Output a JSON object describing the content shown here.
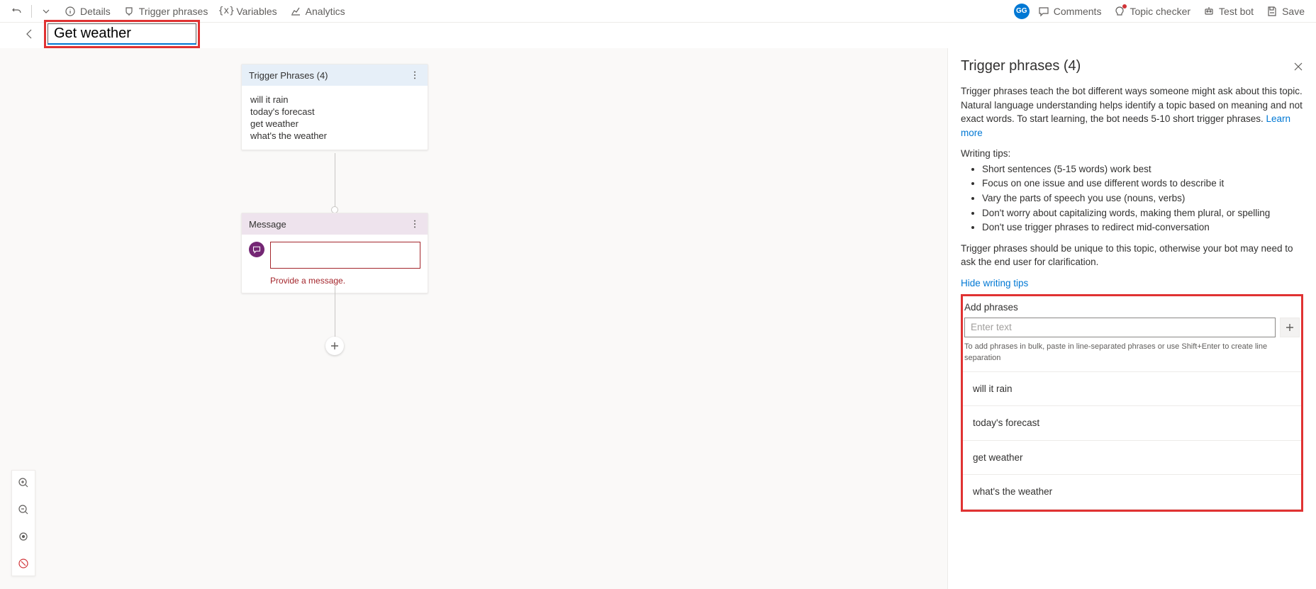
{
  "toolbar": {
    "undo_title": "Undo",
    "details": "Details",
    "trigger_phrases": "Trigger phrases",
    "variables": "Variables",
    "analytics": "Analytics",
    "avatar_initials": "GG",
    "comments": "Comments",
    "topic_checker": "Topic checker",
    "test_bot": "Test bot",
    "save": "Save"
  },
  "topic": {
    "name": "Get weather"
  },
  "canvas": {
    "trigger_node": {
      "title": "Trigger Phrases (4)",
      "phrases": [
        "will it rain",
        "today's forecast",
        "get weather",
        "what's the weather"
      ]
    },
    "message_node": {
      "title": "Message",
      "error": "Provide a message."
    }
  },
  "panel": {
    "title": "Trigger phrases (4)",
    "intro_a": "Trigger phrases teach the bot different ways someone might ask about this topic. Natural language understanding helps identify a topic based on meaning and not exact words. To start learning, the bot needs 5-10 short trigger phrases. ",
    "learn_more": "Learn more",
    "tips_title": "Writing tips:",
    "tips": [
      "Short sentences (5-15 words) work best",
      "Focus on one issue and use different words to describe it",
      "Vary the parts of speech you use (nouns, verbs)",
      "Don't worry about capitalizing words, making them plural, or spelling",
      "Don't use trigger phrases to redirect mid-conversation"
    ],
    "unique_note": "Trigger phrases should be unique to this topic, otherwise your bot may need to ask the end user for clarification.",
    "hide_tips": "Hide writing tips",
    "add_label": "Add phrases",
    "add_placeholder": "Enter text",
    "bulk_hint": "To add phrases in bulk, paste in line-separated phrases or use Shift+Enter to create line separation",
    "phrases": [
      "will it rain",
      "today's forecast",
      "get weather",
      "what's the weather"
    ]
  }
}
